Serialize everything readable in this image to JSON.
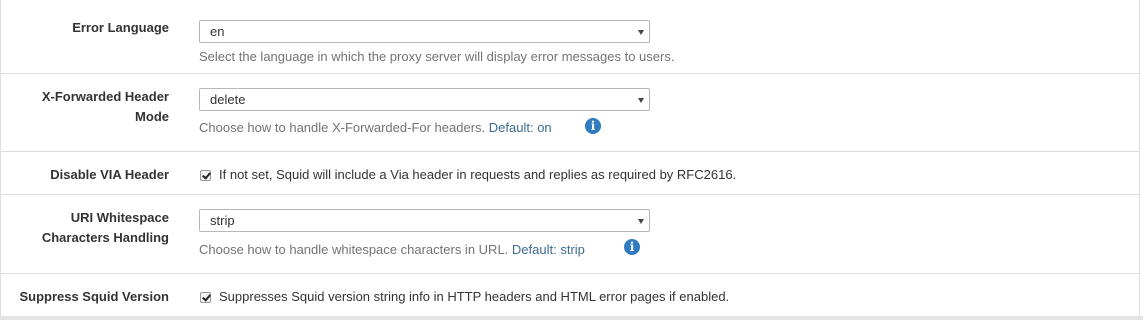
{
  "error_language": {
    "label": "Error Language",
    "value": "en",
    "help": "Select the language in which the proxy server will display error messages to users."
  },
  "x_forwarded": {
    "label_line1": "X-Forwarded Header",
    "label_line2": "Mode",
    "value": "delete",
    "help": "Choose how to handle X-Forwarded-For headers.",
    "default_text": "Default: on"
  },
  "disable_via": {
    "label": "Disable VIA Header",
    "checked": true,
    "text": "If not set, Squid will include a Via header in requests and replies as required by RFC2616."
  },
  "uri_whitespace": {
    "label_line1": "URI Whitespace",
    "label_line2": "Characters Handling",
    "value": "strip",
    "help": "Choose how to handle whitespace characters in URL.",
    "default_text": "Default: strip"
  },
  "suppress_version": {
    "label": "Suppress Squid Version",
    "checked": true,
    "text": "Suppresses Squid version string info in HTTP headers and HTML error pages if enabled."
  },
  "icons": {
    "info": "info-circle-icon",
    "caret": "chevron-down-icon",
    "check": "checkmark-icon"
  },
  "colors": {
    "info_icon": "#2f7cc1",
    "default_link": "#3d6b92",
    "help_text": "#737373",
    "border": "#dddddd"
  }
}
